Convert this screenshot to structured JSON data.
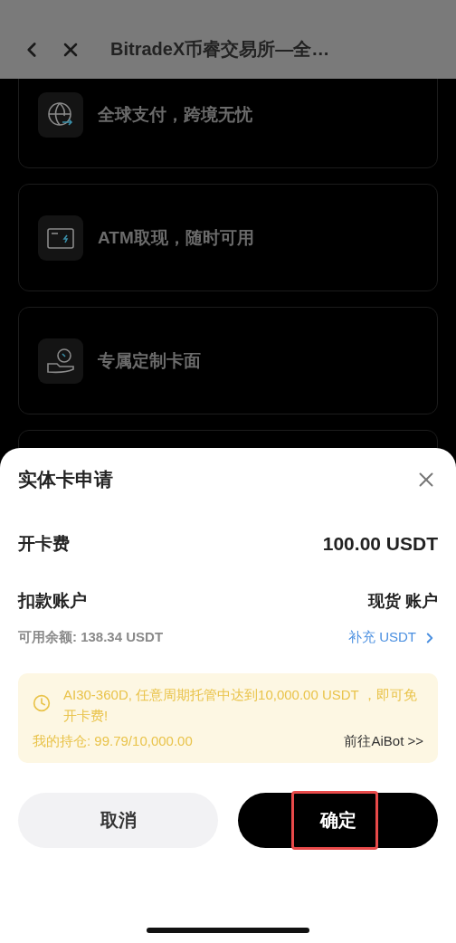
{
  "header": {
    "title": "BitradeX币睿交易所—全…"
  },
  "features": [
    {
      "label": "全球支付，跨境无忧"
    },
    {
      "label": "ATM取现，随时可用"
    },
    {
      "label": "专属定制卡面"
    }
  ],
  "sheet": {
    "title": "实体卡申请",
    "fee": {
      "label": "开卡费",
      "value": "100.00 USDT"
    },
    "account": {
      "label": "扣款账户",
      "value": "现货 账户"
    },
    "balance": "可用余额: 138.34 USDT",
    "topup": "补充 USDT",
    "notice": {
      "text": "AI30-360D, 任意周期托管中达到10,000.00 USDT ，即可免开卡费!",
      "holding": "我的持仓: 99.79/10,000.00",
      "link": "前往AiBot >>"
    },
    "buttons": [
      {
        "label": "取消",
        "kind": "secondary",
        "highlighted": false
      },
      {
        "label": "确定",
        "kind": "primary",
        "highlighted": true
      }
    ]
  }
}
